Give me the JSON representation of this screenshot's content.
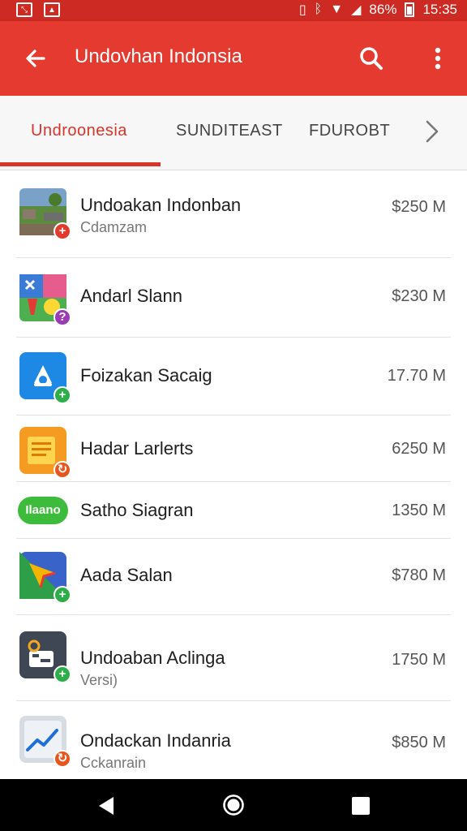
{
  "status_bar": {
    "battery_text": "86%",
    "time": "15:35"
  },
  "app_bar": {
    "title": "Undovhan Indonsia"
  },
  "tabs": [
    {
      "label": "Undroonesia",
      "active": true
    },
    {
      "label": "SUNDITEAST",
      "active": false
    },
    {
      "label": "FDUROBT",
      "active": false
    }
  ],
  "apps": [
    {
      "name": "Undoakan Indonban",
      "subtitle": "Cdamzam",
      "size": "$250 M",
      "icon": "landscape-photo-icon",
      "badge": "+",
      "badge_color": "#e23b2e"
    },
    {
      "name": "Andarl Slann",
      "subtitle": "",
      "size": "$230 M",
      "icon": "colorful-game-icon",
      "badge": "?",
      "badge_color": "#9b3bb5"
    },
    {
      "name": "Foizakan Sacaig",
      "subtitle": "",
      "size": "17.70 M",
      "icon": "blue-bell-icon",
      "badge": "+",
      "badge_color": "#2eae4a"
    },
    {
      "name": "Hadar Larlerts",
      "subtitle": "",
      "size": "6250 M",
      "icon": "orange-document-icon",
      "badge": "↻",
      "badge_color": "#e8561f"
    },
    {
      "name": "Satho Siagran",
      "subtitle": "",
      "size": "1350 M",
      "icon": "green-pill-icon",
      "icon_text": "Ilaano",
      "badge": "",
      "badge_color": ""
    },
    {
      "name": "Aada Salan",
      "subtitle": "",
      "size": "$780 M",
      "icon": "star-arrow-icon",
      "badge": "+",
      "badge_color": "#2eae4a"
    },
    {
      "name": "Undoaban Aclinga",
      "subtitle": "Versi)",
      "size": "1750 M",
      "icon": "dark-chat-icon",
      "badge": "+",
      "badge_color": "#2eae4a"
    },
    {
      "name": "Ondackan Indanria",
      "subtitle": "Cckanrain",
      "size": "$850 M",
      "icon": "chart-line-icon",
      "badge": "↻",
      "badge_color": "#e8561f"
    }
  ],
  "colors": {
    "status_bar": "#cc2a22",
    "app_bar": "#e53a2f",
    "accent": "#d8342a"
  }
}
